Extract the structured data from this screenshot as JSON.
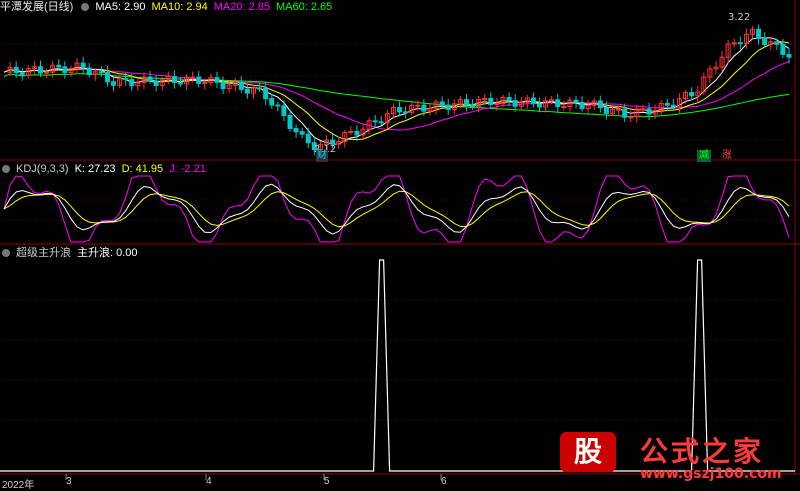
{
  "main_header": {
    "title": "平潭发展(日线)",
    "ma5": "MA5: 2.90",
    "ma10": "MA10: 2.94",
    "ma20": "MA20: 2.85",
    "ma60": "MA60: 2.65"
  },
  "kdj_header": {
    "name": "KDJ(9,3,3)",
    "k": "K: 27.23",
    "d": "D: 41.95",
    "j": "J: -2.21"
  },
  "ind_header": {
    "name": "超级主升浪",
    "value": "主升浪: 0.00"
  },
  "annotations": {
    "high": "3.22",
    "low": "2.12",
    "cai": "财",
    "jian": "减",
    "zhang": "涨"
  },
  "x_ticks": [
    "2022年",
    "3",
    "4",
    "5",
    "6"
  ],
  "watermark": {
    "logo": "股",
    "name": "公式之家",
    "url": "www.gszj100.com"
  },
  "colors": {
    "bg": "#000000",
    "divider": "#8b0000",
    "up": "#ff3232",
    "down": "#00c8c8",
    "ma5": "#ffffff",
    "ma10": "#ffff00",
    "ma20": "#ff00ff",
    "ma60": "#00ff00",
    "kdj_k": "#ffffff",
    "kdj_d": "#ffff00",
    "kdj_j": "#ff00ff",
    "signal": "#ffffff"
  },
  "chart_data": {
    "type": "candlestick+line",
    "price_range": [
      2.12,
      3.22
    ],
    "annotated_high": 3.22,
    "annotated_low": 2.12,
    "ma_last": {
      "MA5": 2.9,
      "MA10": 2.94,
      "MA20": 2.85,
      "MA60": 2.65
    },
    "kdj_last": {
      "K": 27.23,
      "D": 41.95,
      "J": -2.21
    },
    "signal_series": {
      "name": "主升浪",
      "last_value": 0.0,
      "pulses_at_fraction_of_range": [
        0.48,
        0.88
      ]
    }
  }
}
